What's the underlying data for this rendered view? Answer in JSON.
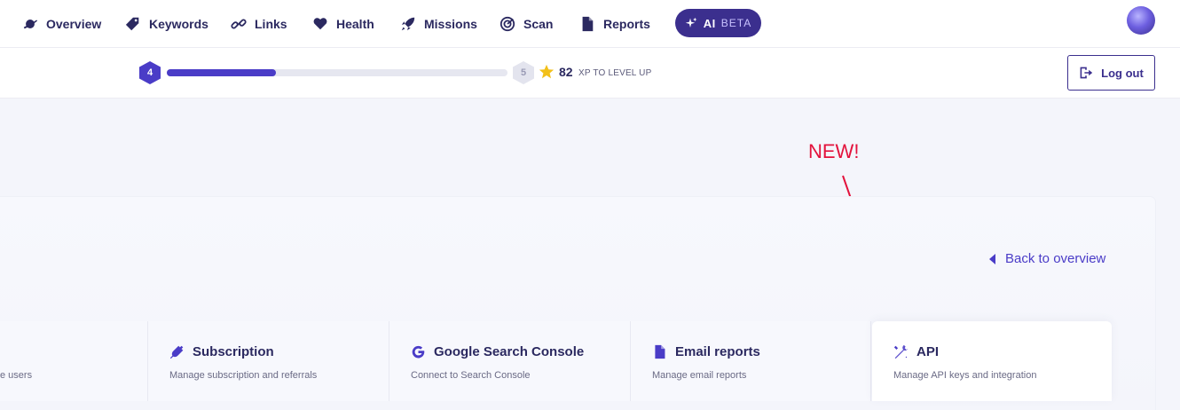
{
  "nav": {
    "items": [
      {
        "label": "Overview",
        "icon": "planet-icon"
      },
      {
        "label": "Keywords",
        "icon": "tag-icon"
      },
      {
        "label": "Links",
        "icon": "link-icon"
      },
      {
        "label": "Health",
        "icon": "heart-icon"
      },
      {
        "label": "Missions",
        "icon": "rocket-icon"
      },
      {
        "label": "Scan",
        "icon": "radar-icon"
      },
      {
        "label": "Reports",
        "icon": "document-icon"
      }
    ],
    "ai_label": "AI",
    "ai_badge": "BETA"
  },
  "level": {
    "current": "4",
    "next": "5",
    "progress": 0.32,
    "xp": "82",
    "xp_label": "XP TO LEVEL UP"
  },
  "logout_label": "Log out",
  "annotation": "NEW!",
  "back_link": "Back to overview",
  "cards": [
    {
      "title": "",
      "subtitle": "e users"
    },
    {
      "title": "Subscription",
      "subtitle": "Manage subscription and referrals",
      "icon": "plug-icon"
    },
    {
      "title": "Google Search Console",
      "subtitle": "Connect to Search Console",
      "icon": "google-icon"
    },
    {
      "title": "Email reports",
      "subtitle": "Manage email reports",
      "icon": "document-icon"
    },
    {
      "title": "API",
      "subtitle": "Manage API keys and integration",
      "icon": "tools-icon"
    }
  ],
  "colors": {
    "accent": "#4a3cc7",
    "dark": "#2b2960",
    "annotation": "#e3123c",
    "star": "#f2c01a"
  }
}
